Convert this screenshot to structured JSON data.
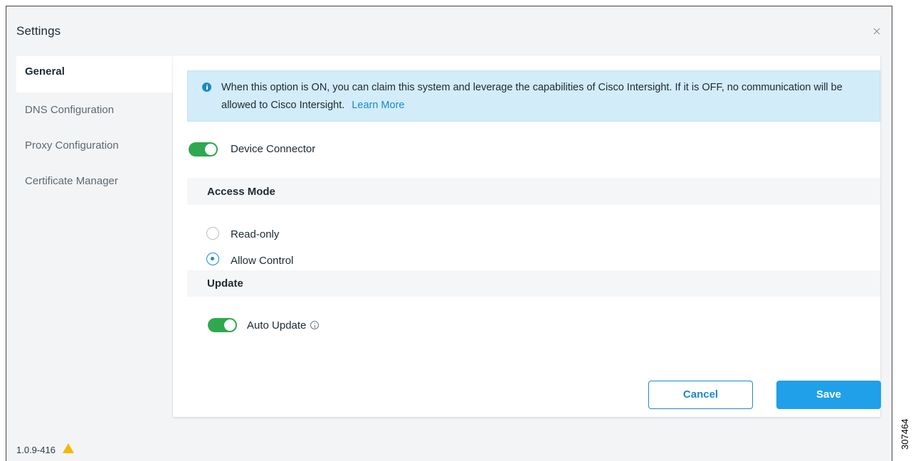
{
  "dialog": {
    "title": "Settings",
    "close_icon": "close-icon"
  },
  "sidebar": {
    "items": [
      {
        "label": "General",
        "active": true
      },
      {
        "label": "DNS Configuration",
        "active": false
      },
      {
        "label": "Proxy Configuration",
        "active": false
      },
      {
        "label": "Certificate Manager",
        "active": false
      }
    ]
  },
  "banner": {
    "icon": "info-icon",
    "text": "When this option is ON, you can claim this system and leverage the capabilities of Cisco Intersight. If it is OFF, no communication will be allowed to Cisco Intersight.",
    "link": "Learn More"
  },
  "device_connector": {
    "label": "Device Connector",
    "enabled": true
  },
  "access_mode": {
    "title": "Access Mode",
    "options": [
      {
        "label": "Read-only",
        "selected": false
      },
      {
        "label": "Allow Control",
        "selected": true
      }
    ]
  },
  "update": {
    "title": "Update",
    "auto_update_label": "Auto Update",
    "enabled": true,
    "info_icon": "info-icon"
  },
  "buttons": {
    "cancel": "Cancel",
    "save": "Save"
  },
  "footer": {
    "version": "1.0.9-416",
    "warning_icon": "warning-icon"
  },
  "figure_number": "307464",
  "colors": {
    "accent": "#1a8ad0",
    "toggle_on": "#2fa84f",
    "banner_bg": "#d2ecf9",
    "warning": "#f5b800"
  }
}
